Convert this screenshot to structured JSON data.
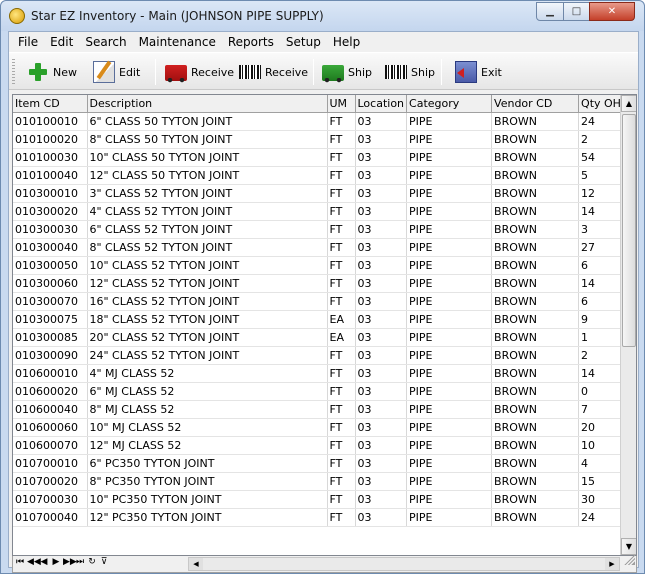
{
  "window": {
    "title": "Star EZ Inventory - Main (JOHNSON PIPE SUPPLY)",
    "controls": {
      "minimize": "▁",
      "maximize": "□",
      "close": "✕"
    }
  },
  "menu": [
    "File",
    "Edit",
    "Search",
    "Maintenance",
    "Reports",
    "Setup",
    "Help"
  ],
  "toolbar": {
    "new_label": "New",
    "edit_label": "Edit",
    "receive_label": "Receive",
    "receive_barcode_label": "Receive",
    "ship_label": "Ship",
    "ship_barcode_label": "Ship",
    "exit_label": "Exit"
  },
  "grid": {
    "columns": [
      "Item CD",
      "Description",
      "UM",
      "Location",
      "Category",
      "Vendor CD",
      "Qty OH"
    ],
    "rows": [
      [
        "010100010",
        "6\" CLASS 50 TYTON JOINT",
        "FT",
        "03",
        "PIPE",
        "BROWN",
        "24"
      ],
      [
        "010100020",
        "8\" CLASS 50 TYTON JOINT",
        "FT",
        "03",
        "PIPE",
        "BROWN",
        "2"
      ],
      [
        "010100030",
        "10\" CLASS 50 TYTON JOINT",
        "FT",
        "03",
        "PIPE",
        "BROWN",
        "54"
      ],
      [
        "010100040",
        "12\" CLASS 50 TYTON JOINT",
        "FT",
        "03",
        "PIPE",
        "BROWN",
        "5"
      ],
      [
        "010300010",
        "3\" CLASS 52 TYTON JOINT",
        "FT",
        "03",
        "PIPE",
        "BROWN",
        "12"
      ],
      [
        "010300020",
        "4\" CLASS 52 TYTON JOINT",
        "FT",
        "03",
        "PIPE",
        "BROWN",
        "14"
      ],
      [
        "010300030",
        "6\" CLASS 52 TYTON JOINT",
        "FT",
        "03",
        "PIPE",
        "BROWN",
        "3"
      ],
      [
        "010300040",
        "8\" CLASS 52 TYTON JOINT",
        "FT",
        "03",
        "PIPE",
        "BROWN",
        "27"
      ],
      [
        "010300050",
        "10\" CLASS 52 TYTON JOINT",
        "FT",
        "03",
        "PIPE",
        "BROWN",
        "6"
      ],
      [
        "010300060",
        "12\" CLASS 52 TYTON JOINT",
        "FT",
        "03",
        "PIPE",
        "BROWN",
        "14"
      ],
      [
        "010300070",
        "16\" CLASS 52 TYTON JOINT",
        "FT",
        "03",
        "PIPE",
        "BROWN",
        "6"
      ],
      [
        "010300075",
        "18\" CLASS 52 TYTON JOINT",
        "EA",
        "03",
        "PIPE",
        "BROWN",
        "9"
      ],
      [
        "010300085",
        "20\" CLASS 52 TYTON JOINT",
        "EA",
        "03",
        "PIPE",
        "BROWN",
        "1"
      ],
      [
        "010300090",
        "24\" CLASS 52 TYTON JOINT",
        "FT",
        "03",
        "PIPE",
        "BROWN",
        "2"
      ],
      [
        "010600010",
        "4\" MJ CLASS 52",
        "FT",
        "03",
        "PIPE",
        "BROWN",
        "14"
      ],
      [
        "010600020",
        "6\" MJ CLASS 52",
        "FT",
        "03",
        "PIPE",
        "BROWN",
        "0"
      ],
      [
        "010600040",
        "8\" MJ CLASS 52",
        "FT",
        "03",
        "PIPE",
        "BROWN",
        "7"
      ],
      [
        "010600060",
        "10\" MJ CLASS 52",
        "FT",
        "03",
        "PIPE",
        "BROWN",
        "20"
      ],
      [
        "010600070",
        "12\" MJ CLASS 52",
        "FT",
        "03",
        "PIPE",
        "BROWN",
        "10"
      ],
      [
        "010700010",
        "6\" PC350 TYTON JOINT",
        "FT",
        "03",
        "PIPE",
        "BROWN",
        "4"
      ],
      [
        "010700020",
        "8\" PC350 TYTON JOINT",
        "FT",
        "03",
        "PIPE",
        "BROWN",
        "15"
      ],
      [
        "010700030",
        "10\" PC350 TYTON JOINT",
        "FT",
        "03",
        "PIPE",
        "BROWN",
        "30"
      ],
      [
        "010700040",
        "12\" PC350 TYTON JOINT",
        "FT",
        "03",
        "PIPE",
        "BROWN",
        "24"
      ]
    ]
  },
  "navigator": [
    "⏮",
    "◀◀",
    "◀",
    "▶",
    "▶▶",
    "⏭",
    "↻",
    "⊽"
  ],
  "scroll": {
    "up": "▲",
    "down": "▼",
    "left": "◀",
    "right": "▶"
  }
}
